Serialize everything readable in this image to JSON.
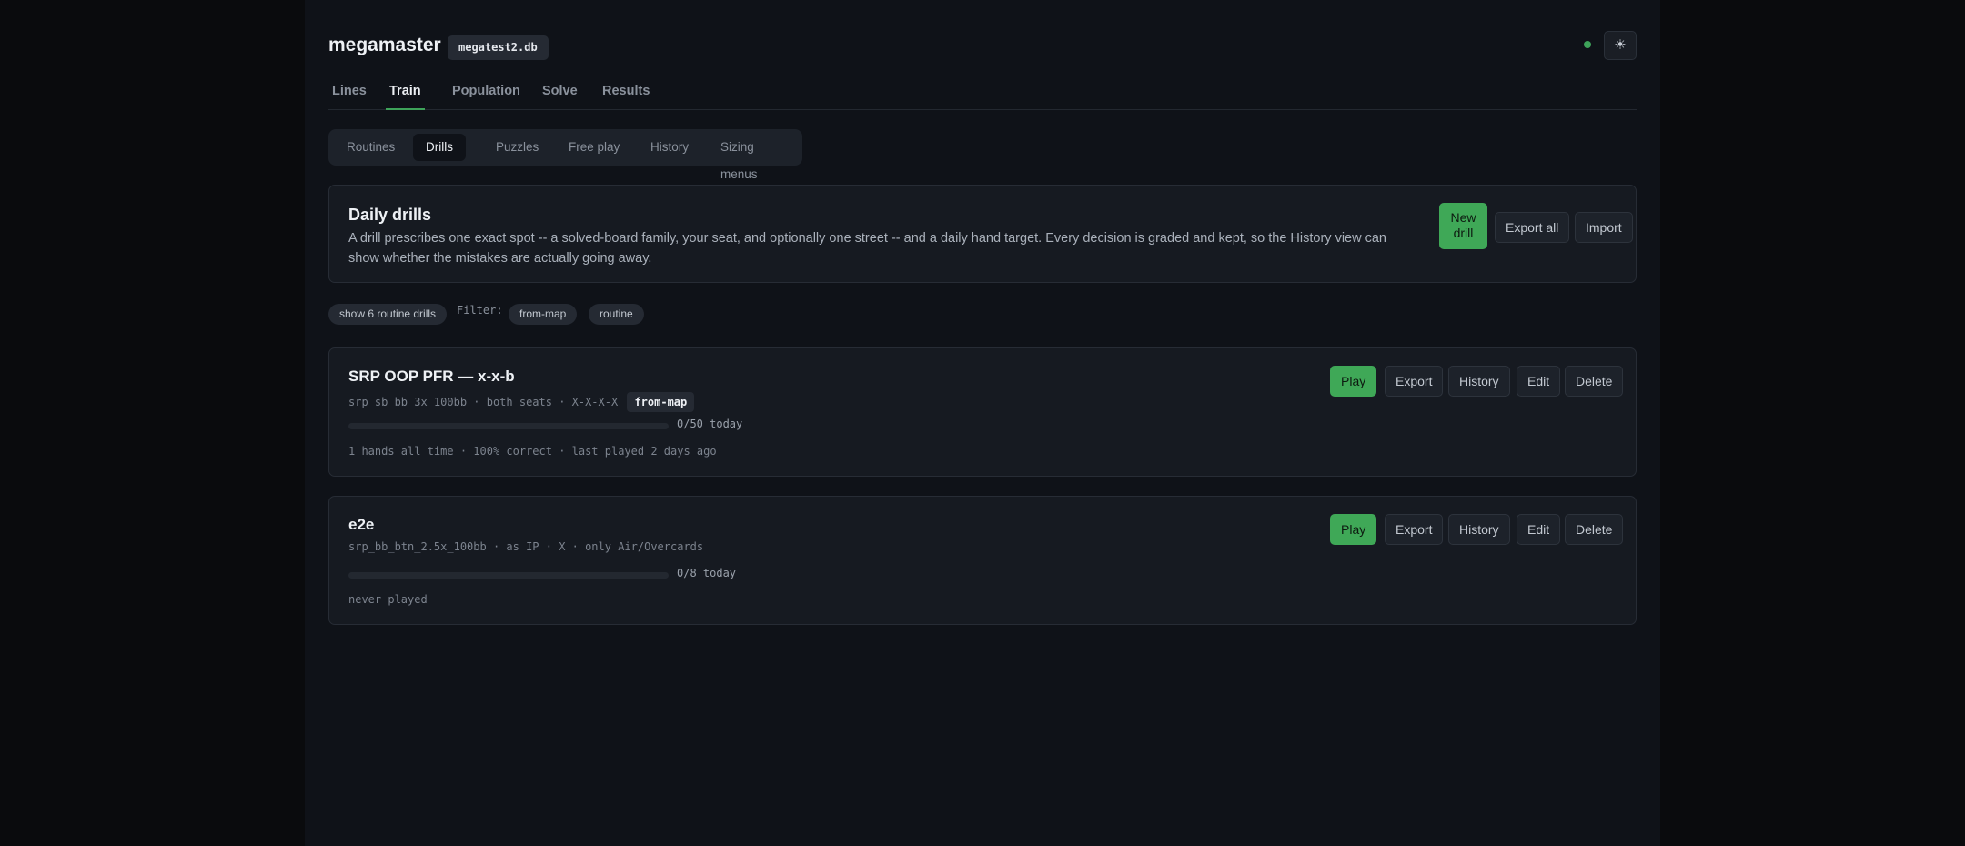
{
  "app": {
    "title": "megamaster",
    "db": "megatest2.db",
    "theme_icon": "sun-icon"
  },
  "tabs": [
    "Lines",
    "Train",
    "Population",
    "Solve",
    "Results"
  ],
  "active_tab": "Train",
  "subtabs": [
    "Routines",
    "Drills",
    "Puzzles",
    "Free play",
    "History",
    "Sizing menus"
  ],
  "active_subtab": "Drills",
  "intro": {
    "title": "Daily drills",
    "description": "A drill prescribes one exact spot -- a solved-board family, your seat, and optionally one street -- and a daily hand target. Every decision is graded and kept, so the History view can show whether the mistakes are actually going away.",
    "new_drill": "New drill",
    "export_all": "Export all",
    "import": "Import"
  },
  "filter": {
    "toggle": "show 6 routine drills",
    "label": "Filter:",
    "tags": [
      "from-map",
      "routine"
    ]
  },
  "drills": [
    {
      "title": "SRP OOP PFR — x-x-b",
      "meta": "srp_sb_bb_3x_100bb · both seats · X-X-X-X",
      "tag": "from-map",
      "progress": 0,
      "progress_text": "0/50 today",
      "stats": "1 hands all time · 100% correct · last played 2 days ago",
      "actions": {
        "play": "Play",
        "export": "Export",
        "history": "History",
        "edit": "Edit",
        "delete": "Delete"
      }
    },
    {
      "title": "e2e",
      "meta": "srp_bb_btn_2.5x_100bb · as IP · X · only Air/Overcards",
      "tag": "",
      "progress": 0,
      "progress_text": "0/8 today",
      "stats": "never played",
      "actions": {
        "play": "Play",
        "export": "Export",
        "history": "History",
        "edit": "Edit",
        "delete": "Delete"
      }
    }
  ],
  "colors": {
    "accent": "#3ea35a",
    "background": "#0f1218",
    "card": "#161a21"
  }
}
